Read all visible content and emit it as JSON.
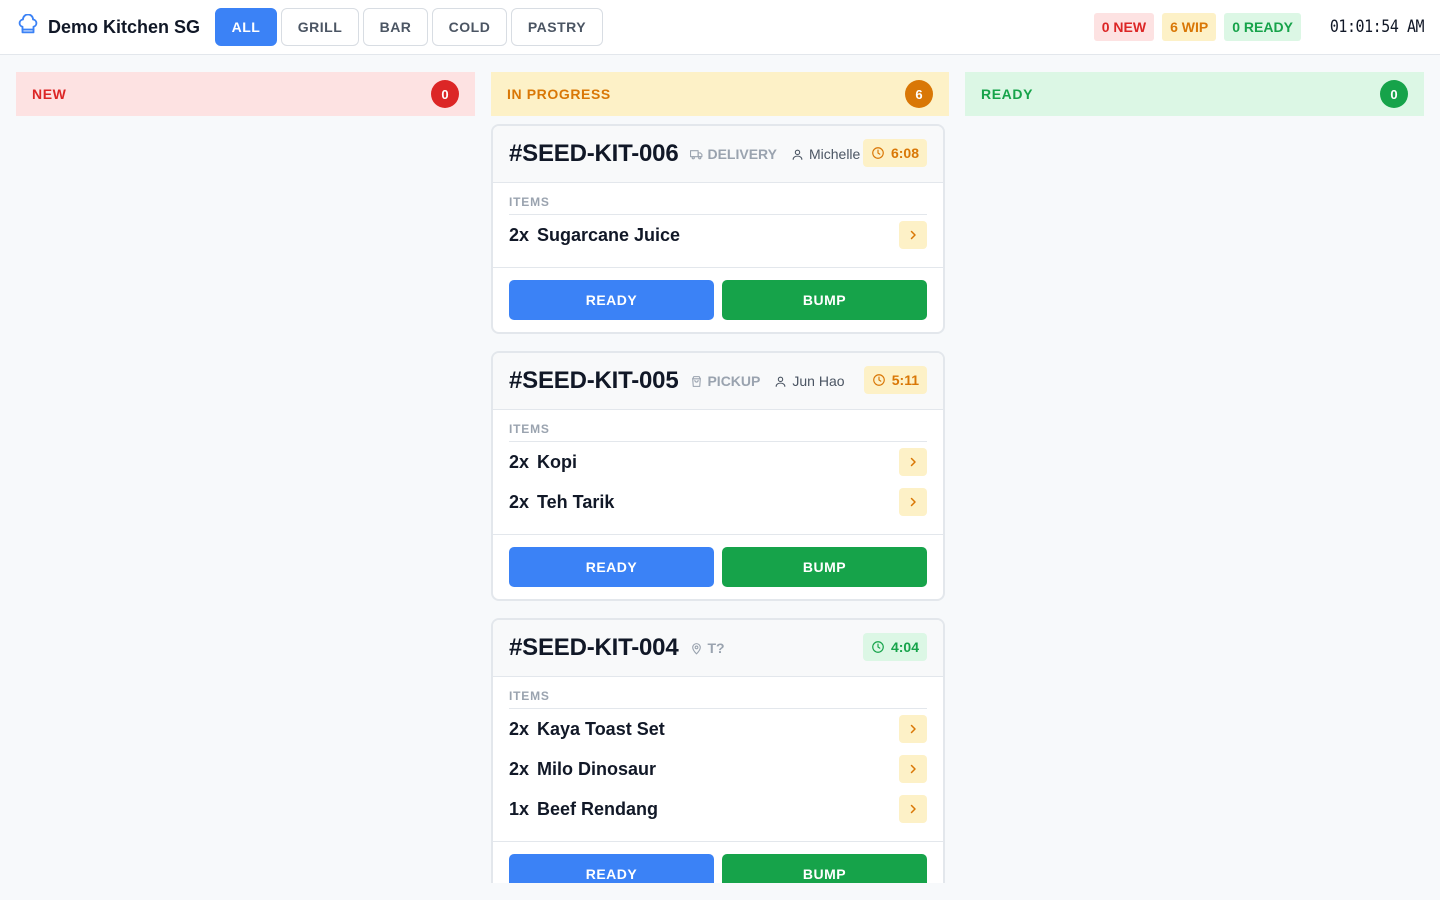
{
  "header": {
    "brand_icon": "chef-hat-icon",
    "brand_name": "Demo Kitchen SG",
    "tabs": [
      {
        "label": "ALL",
        "active": true
      },
      {
        "label": "GRILL",
        "active": false
      },
      {
        "label": "BAR",
        "active": false
      },
      {
        "label": "COLD",
        "active": false
      },
      {
        "label": "PASTRY",
        "active": false
      }
    ],
    "stats": {
      "new": "0 NEW",
      "wip": "6 WIP",
      "ready": "0 READY"
    },
    "clock": "01:01:54 AM"
  },
  "columns": [
    {
      "title": "NEW",
      "count": "0",
      "color": "#dc2626"
    },
    {
      "title": "IN PROGRESS",
      "count": "6",
      "color": "#d97706"
    },
    {
      "title": "READY",
      "count": "0",
      "color": "#16a34a"
    }
  ],
  "orders": [
    {
      "id": "#SEED-KIT-006",
      "type_icon": "truck-icon",
      "type": "DELIVERY",
      "customer": "Michelle",
      "timer": "6:08",
      "timer_status": "warning",
      "items_label": "ITEMS",
      "items": [
        {
          "qty": "2x",
          "name": "Sugarcane Juice"
        }
      ],
      "ready_label": "READY",
      "bump_label": "BUMP"
    },
    {
      "id": "#SEED-KIT-005",
      "type_icon": "bag-icon",
      "type": "PICKUP",
      "customer": "Jun Hao",
      "timer": "5:11",
      "timer_status": "warning",
      "items_label": "ITEMS",
      "items": [
        {
          "qty": "2x",
          "name": "Kopi"
        },
        {
          "qty": "2x",
          "name": "Teh Tarik"
        }
      ],
      "ready_label": "READY",
      "bump_label": "BUMP"
    },
    {
      "id": "#SEED-KIT-004",
      "type_icon": "location-pin-icon",
      "type": "T?",
      "customer": "",
      "timer": "4:04",
      "timer_status": "ok",
      "items_label": "ITEMS",
      "items": [
        {
          "qty": "2x",
          "name": "Kaya Toast Set"
        },
        {
          "qty": "2x",
          "name": "Milo Dinosaur"
        },
        {
          "qty": "1x",
          "name": "Beef Rendang"
        }
      ],
      "ready_label": "READY",
      "bump_label": "BUMP"
    }
  ]
}
